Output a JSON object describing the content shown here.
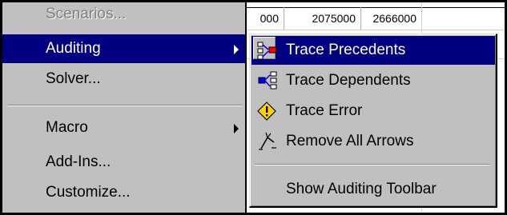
{
  "sheet": {
    "cells": [
      "000",
      "2075000",
      "2666000"
    ]
  },
  "menu": {
    "items": [
      {
        "label": "Scenarios..."
      },
      {
        "label": "Auditing"
      },
      {
        "label": "Solver..."
      },
      {
        "label": "Macro"
      },
      {
        "label": "Add-Ins..."
      },
      {
        "label": "Customize..."
      }
    ]
  },
  "submenu": {
    "items": [
      {
        "label": "Trace Precedents",
        "icon": "trace-precedents-icon"
      },
      {
        "label": "Trace Dependents",
        "icon": "trace-dependents-icon"
      },
      {
        "label": "Trace Error",
        "icon": "trace-error-icon"
      },
      {
        "label": "Remove All Arrows",
        "icon": "remove-arrows-icon"
      },
      {
        "label": "Show Auditing Toolbar"
      }
    ]
  },
  "colors": {
    "menu_bg": "#c0c0c0",
    "highlight": "#000080",
    "disabled_text": "#808080",
    "error_icon": "#ffd200"
  }
}
